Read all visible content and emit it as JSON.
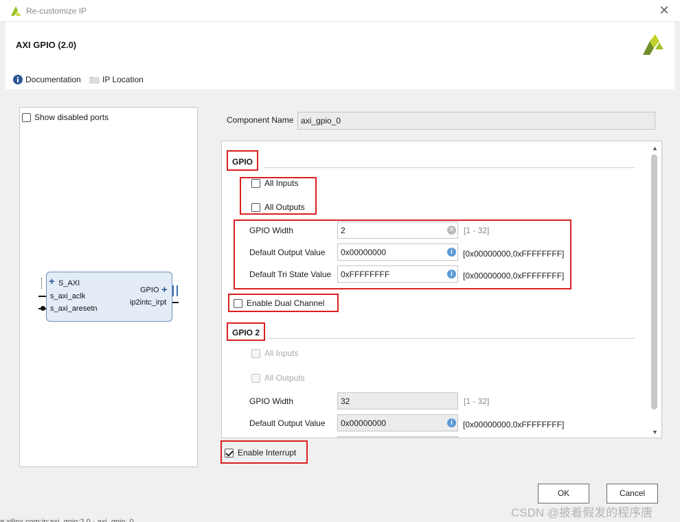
{
  "window": {
    "title": "Re-customize IP",
    "close_glyph": "✕"
  },
  "header": {
    "ip_title": "AXI GPIO (2.0)",
    "documentation_label": "Documentation",
    "ip_location_label": "IP Location"
  },
  "left_panel": {
    "show_disabled_ports_label": "Show disabled ports",
    "block": {
      "bus_name": "S_AXI",
      "clock_port": "s_axi_aclk",
      "reset_port": "s_axi_aresetn",
      "gpio_port": "GPIO",
      "irq_port": "ip2intc_irpt"
    }
  },
  "component": {
    "label": "Component Name",
    "value": "axi_gpio_0"
  },
  "gpio": {
    "title": "GPIO",
    "all_inputs_label": "All Inputs",
    "all_outputs_label": "All Outputs",
    "width_label": "GPIO Width",
    "width_value": "2",
    "width_range": "[1 - 32]",
    "default_output_label": "Default Output Value",
    "default_output_value": "0x00000000",
    "default_output_range": "[0x00000000,0xFFFFFFFF]",
    "default_tri_label": "Default Tri State Value",
    "default_tri_value": "0xFFFFFFFF",
    "default_tri_range": "[0x00000000,0xFFFFFFFF]"
  },
  "dual_channel": {
    "label": "Enable Dual Channel",
    "checked": false
  },
  "gpio2": {
    "title": "GPIO 2",
    "all_inputs_label": "All Inputs",
    "all_outputs_label": "All Outputs",
    "width_label": "GPIO Width",
    "width_value": "32",
    "width_range": "[1 - 32]",
    "default_output_label": "Default Output Value",
    "default_output_value": "0x00000000",
    "default_output_range": "[0x00000000,0xFFFFFFFF]"
  },
  "interrupt": {
    "label": "Enable Interrupt",
    "checked": true
  },
  "footer": {
    "ok_label": "OK",
    "cancel_label": "Cancel"
  },
  "watermark": "CSDN @披着假发的程序唐",
  "background_fragment": "≡ xilinx.com:ip:axi_gpio:2.0 - axi_gpio_0",
  "colors": {
    "highlight_box": "#d91f1f",
    "accent_blue": "#5b9bd5",
    "xilinx_logo": "#9fbf2a"
  }
}
